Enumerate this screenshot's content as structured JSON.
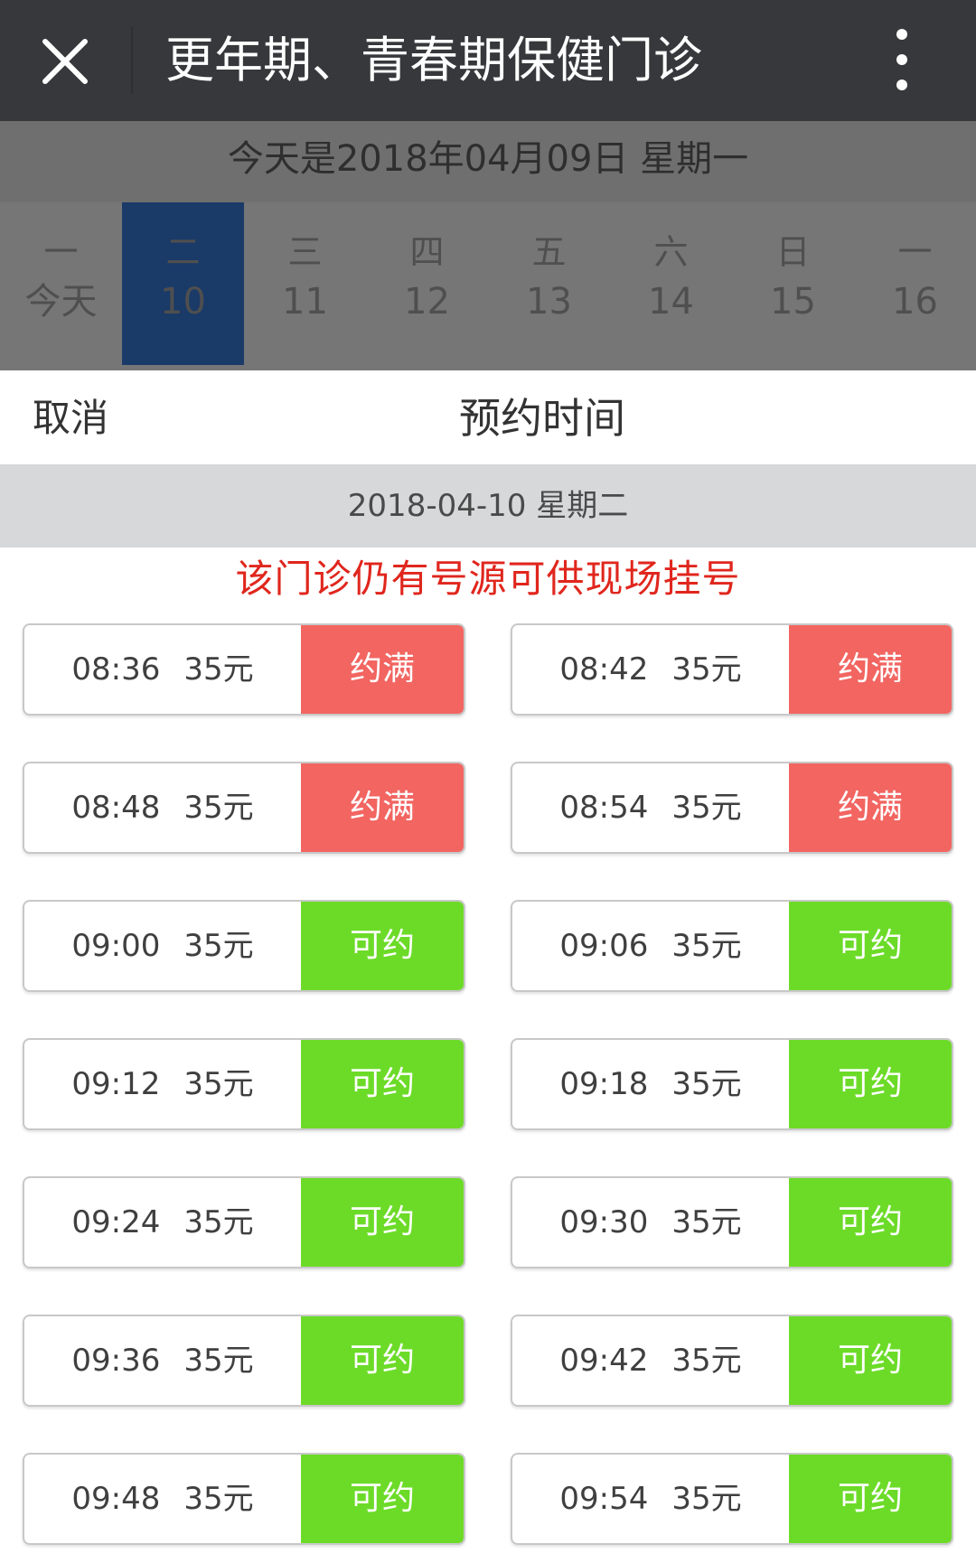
{
  "header": {
    "title": "更年期、青春期保健门诊"
  },
  "background_page": {
    "today_text": "今天是2018年04月09日 星期一",
    "days": [
      {
        "weekday": "一",
        "date": "今天",
        "selected": false
      },
      {
        "weekday": "二",
        "date": "10",
        "selected": true
      },
      {
        "weekday": "三",
        "date": "11",
        "selected": false
      },
      {
        "weekday": "四",
        "date": "12",
        "selected": false
      },
      {
        "weekday": "五",
        "date": "13",
        "selected": false
      },
      {
        "weekday": "六",
        "date": "14",
        "selected": false
      },
      {
        "weekday": "日",
        "date": "15",
        "selected": false
      },
      {
        "weekday": "一",
        "date": "16",
        "selected": false
      }
    ]
  },
  "sheet": {
    "cancel_label": "取消",
    "title": "预约时间",
    "selected_date": "2018-04-10 星期二",
    "notice": "该门诊仍有号源可供现场挂号"
  },
  "colors": {
    "full": "#f26561",
    "available": "#6cdb28",
    "notice_red": "#e0261d",
    "selected_day": "#1a3a68"
  },
  "slots": [
    {
      "time": "08:36",
      "price": "35元",
      "status": "约满",
      "available": false
    },
    {
      "time": "08:42",
      "price": "35元",
      "status": "约满",
      "available": false
    },
    {
      "time": "08:48",
      "price": "35元",
      "status": "约满",
      "available": false
    },
    {
      "time": "08:54",
      "price": "35元",
      "status": "约满",
      "available": false
    },
    {
      "time": "09:00",
      "price": "35元",
      "status": "可约",
      "available": true
    },
    {
      "time": "09:06",
      "price": "35元",
      "status": "可约",
      "available": true
    },
    {
      "time": "09:12",
      "price": "35元",
      "status": "可约",
      "available": true
    },
    {
      "time": "09:18",
      "price": "35元",
      "status": "可约",
      "available": true
    },
    {
      "time": "09:24",
      "price": "35元",
      "status": "可约",
      "available": true
    },
    {
      "time": "09:30",
      "price": "35元",
      "status": "可约",
      "available": true
    },
    {
      "time": "09:36",
      "price": "35元",
      "status": "可约",
      "available": true
    },
    {
      "time": "09:42",
      "price": "35元",
      "status": "可约",
      "available": true
    },
    {
      "time": "09:48",
      "price": "35元",
      "status": "可约",
      "available": true
    },
    {
      "time": "09:54",
      "price": "35元",
      "status": "可约",
      "available": true
    }
  ]
}
